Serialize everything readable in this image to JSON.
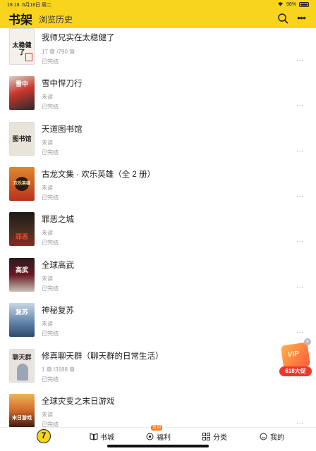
{
  "status_bar": {
    "time": "18:18",
    "date": "6月18日 周二",
    "battery": "98%"
  },
  "header": {
    "title": "书架",
    "tab_history": "浏览历史",
    "search_icon": "search-icon",
    "more_icon": "more-icon"
  },
  "books": [
    {
      "title": "我师兄实在太稳健了",
      "progress": "17 章 /790 章",
      "status": "已完结",
      "cover_text": "太稳健了",
      "cover_bg": "#f4f1ea",
      "cover_fg": "#111"
    },
    {
      "title": "雪中悍刀行",
      "progress": "未读",
      "status": "已完结",
      "cover_text": "雪中",
      "cover_bg": "#c9372c",
      "cover_fg": "#fff"
    },
    {
      "title": "天道图书馆",
      "progress": "未读",
      "status": "已完结",
      "cover_text": "图书馆",
      "cover_bg": "#e9e4da",
      "cover_fg": "#222"
    },
    {
      "title": "古龙文集 · 欢乐英雄（全 2 册）",
      "progress": "未读",
      "status": "已完结",
      "cover_text": "欢乐英雄",
      "cover_bg": "#d4631f",
      "cover_fg": "#ffe9a0"
    },
    {
      "title": "罪恶之城",
      "progress": "未读",
      "status": "已完结",
      "cover_text": "罪恶",
      "cover_bg": "#3a2a1e",
      "cover_fg": "#e04a2c"
    },
    {
      "title": "全球高武",
      "progress": "未读",
      "status": "已完结",
      "cover_text": "高武",
      "cover_bg": "#5a1a1e",
      "cover_fg": "#fff"
    },
    {
      "title": "神秘复苏",
      "progress": "未读",
      "status": "已完结",
      "cover_text": "复苏",
      "cover_bg": "#5c7fa8",
      "cover_fg": "#fff"
    },
    {
      "title": "修真聊天群（聊天群的日常生活）",
      "progress": "1 章 /3188 章",
      "status": "已完结",
      "cover_text": "聊天群",
      "cover_bg": "#e8e3dc",
      "cover_fg": "#333"
    },
    {
      "title": "全球灾变之末日游戏",
      "progress": "未读",
      "status": "已完结",
      "cover_text": "末日游戏",
      "cover_bg": "#d0682a",
      "cover_fg": "#fff"
    }
  ],
  "promo": {
    "vip": "VIP",
    "badge": "618大促",
    "close": "×"
  },
  "tab_bar": {
    "home_char": "7",
    "tabs": [
      {
        "label": "书城",
        "icon": "book-icon"
      },
      {
        "label": "福利",
        "icon": "coin-icon",
        "badge": "签到"
      },
      {
        "label": "分类",
        "icon": "grid-icon"
      },
      {
        "label": "我的",
        "icon": "profile-icon"
      }
    ]
  },
  "colors": {
    "accent": "#f8d51c",
    "muted": "#999999"
  }
}
